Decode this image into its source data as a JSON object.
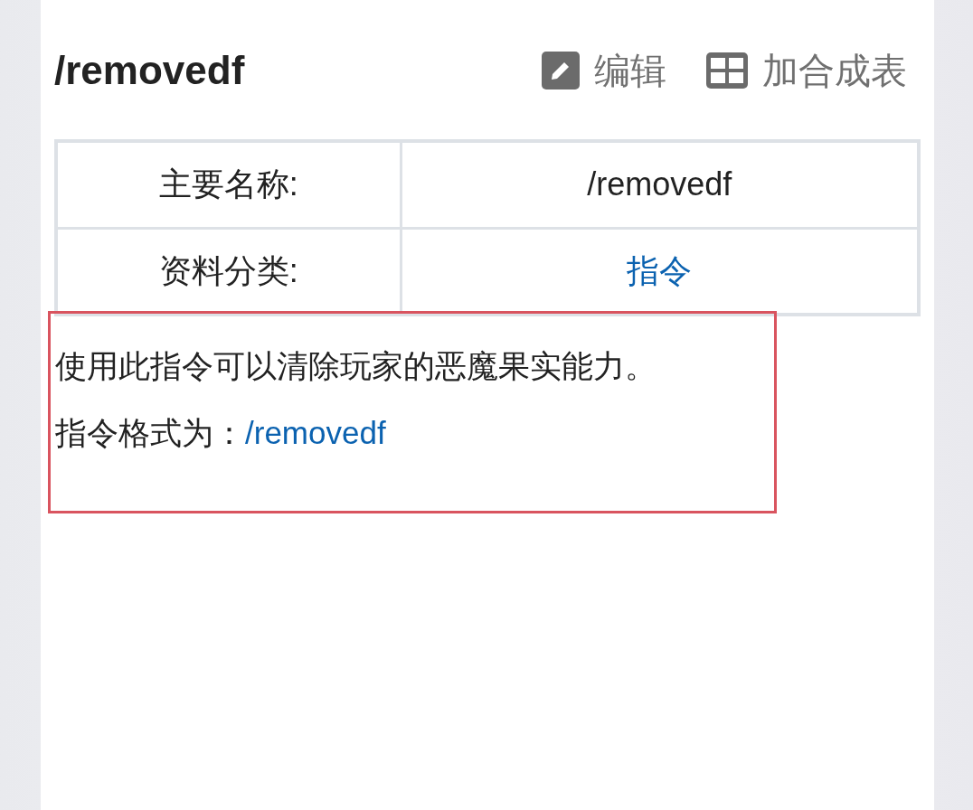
{
  "page_title": "/removedf",
  "actions": [
    {
      "kind": "edit",
      "label": "编辑"
    },
    {
      "kind": "table",
      "label": "加合成表"
    }
  ],
  "infobox": [
    {
      "label": "主要名称:",
      "value": "/removedf",
      "link": false
    },
    {
      "label": "资料分类:",
      "value": "指令",
      "link": true
    }
  ],
  "paragraphs": [
    {
      "text": "使用此指令可以清除玩家的恶魔果实能力。"
    },
    {
      "text": "指令格式为：",
      "link": "/removedf"
    }
  ]
}
